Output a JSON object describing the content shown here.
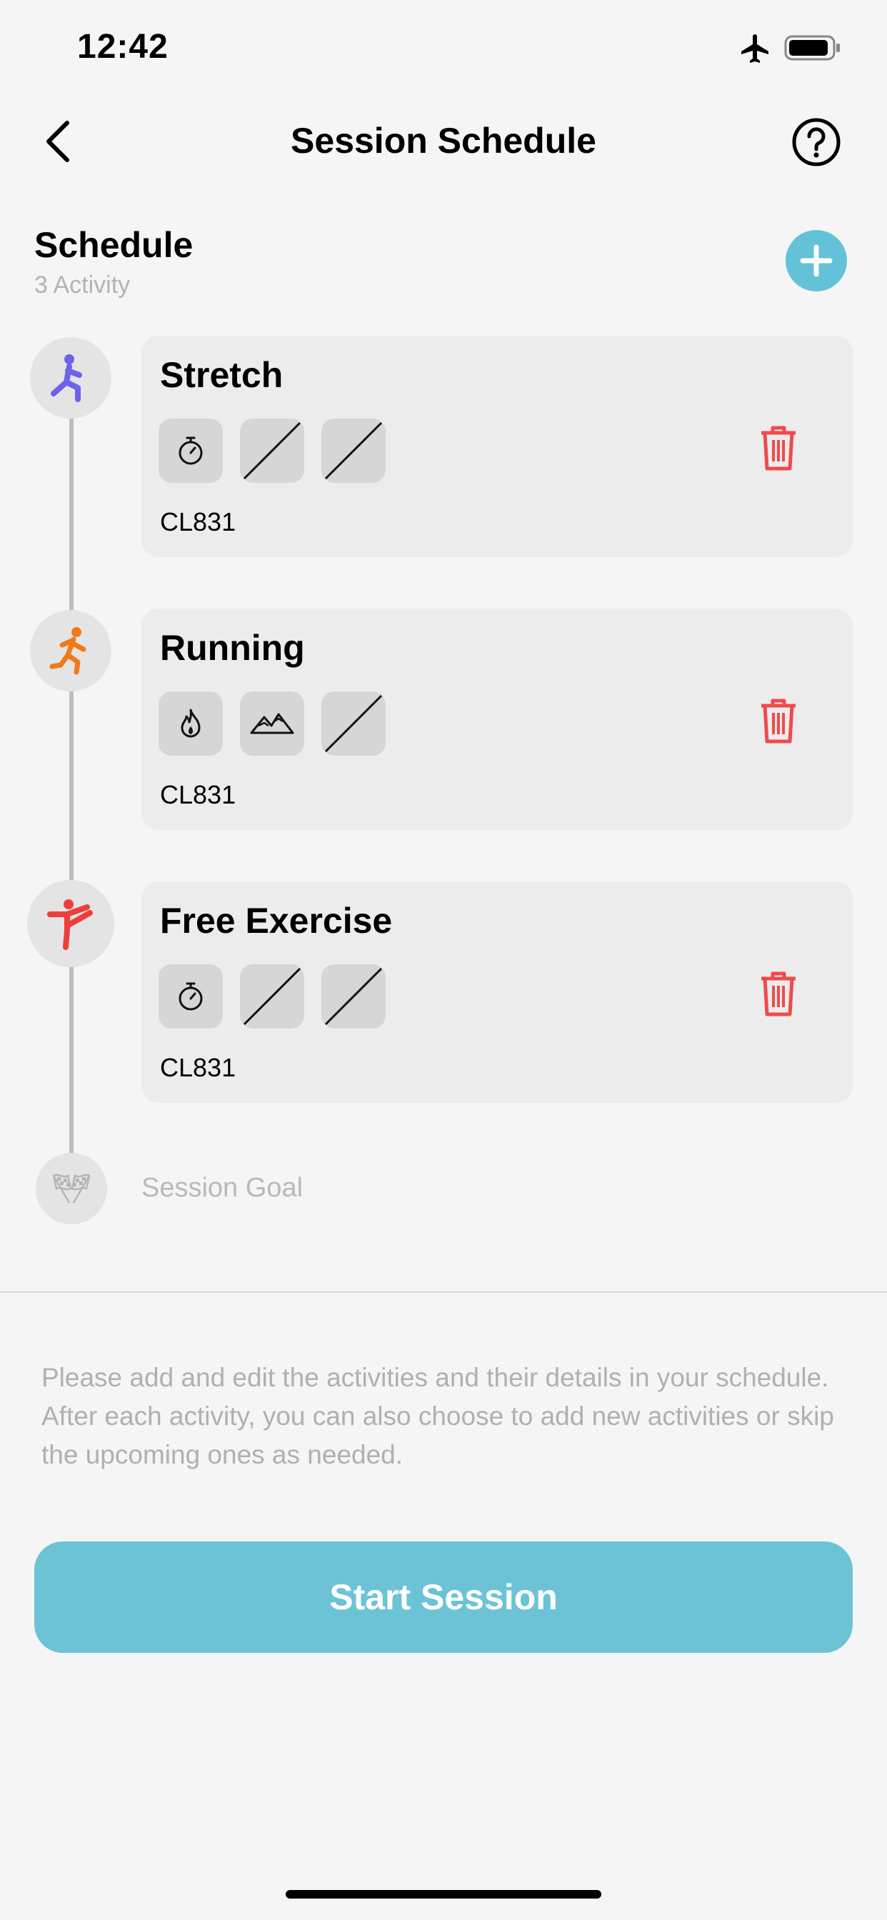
{
  "status_bar": {
    "time": "12:42"
  },
  "nav": {
    "title": "Session Schedule"
  },
  "schedule": {
    "title": "Schedule",
    "count": "3 Activity"
  },
  "activities": [
    {
      "name": "Stretch",
      "code": "CL831",
      "icon": "stretch-figure-icon",
      "color": "#6c63e8",
      "metrics": [
        "timer-icon",
        "empty",
        "empty"
      ]
    },
    {
      "name": "Running",
      "code": "CL831",
      "icon": "running-figure-icon",
      "color": "#f07a1a",
      "metrics": [
        "flame-icon",
        "mountain-icon",
        "empty"
      ]
    },
    {
      "name": "Free Exercise",
      "code": "CL831",
      "icon": "free-exercise-figure-icon",
      "color": "#f03c3c",
      "metrics": [
        "timer-icon",
        "empty",
        "empty"
      ]
    }
  ],
  "goal": {
    "label": "Session Goal",
    "icon": "checkered-flags-icon"
  },
  "hint": "Please add and edit the activities and their details in your schedule. After each activity, you can also choose to add new activities or skip the upcoming ones as needed.",
  "start_button": {
    "label": "Start Session"
  },
  "colors": {
    "accent": "#63c2d8",
    "delete": "#f04a4a"
  }
}
